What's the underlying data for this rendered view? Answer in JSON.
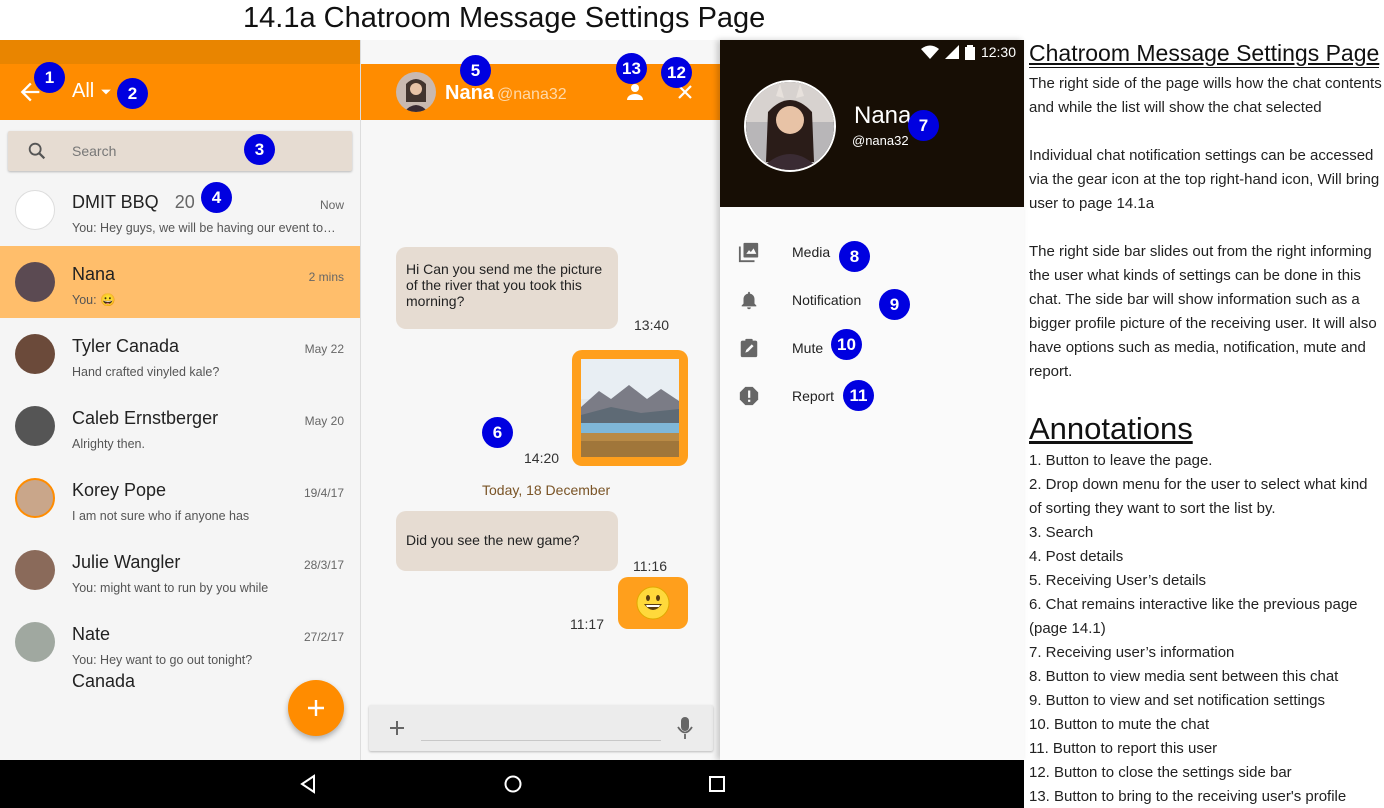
{
  "page_title": "14.1a Chatroom Message Settings Page",
  "list_panel": {
    "filter_label": "All",
    "search_placeholder": "Search",
    "chats": [
      {
        "name": "DMIT BBQ",
        "count": "20",
        "preview": "You: Hey guys, we will be having our event to…",
        "time": "Now",
        "avatar_color": "#ffffff"
      },
      {
        "name": "Nana",
        "count": "",
        "preview": "You: 😀",
        "time": "2 mins",
        "avatar_color": "#5b4a52"
      },
      {
        "name": "Tyler Canada",
        "count": "",
        "preview": "Hand crafted vinyled kale?",
        "time": "May 22",
        "avatar_color": "#6b4a3a"
      },
      {
        "name": "Caleb Ernstberger",
        "count": "",
        "preview": "Alrighty then.",
        "time": "May 20",
        "avatar_color": "#555555"
      },
      {
        "name": "Korey Pope",
        "count": "",
        "preview": "I am not sure who if anyone has",
        "time": "19/4/17",
        "avatar_color": "#c9a68a"
      },
      {
        "name": "Julie Wangler",
        "count": "",
        "preview": "You: might want to run by you while",
        "time": "28/3/17",
        "avatar_color": "#8a6a5a"
      },
      {
        "name": "Nate",
        "count": "",
        "preview": "You: Hey want to go out tonight?",
        "time": "27/2/17",
        "avatar_color": "#a0a8a0"
      }
    ],
    "overflow_text": "Canada"
  },
  "chat_panel": {
    "contact_name": "Nana",
    "contact_handle": "@nana32",
    "messages": [
      {
        "text": "Hi Can you send me the picture of the river that you took this morning?",
        "time": "13:40"
      },
      {
        "time": "14:20"
      },
      {
        "text": "Did you see the new game?",
        "time": "11:16"
      },
      {
        "emoji": "😀",
        "time": "11:17"
      }
    ],
    "date_divider": "Today, 18 December"
  },
  "sidebar": {
    "status_time": "12:30",
    "name": "Nana",
    "handle": "@nana32",
    "menu": [
      {
        "label": "Media",
        "icon": "media-icon"
      },
      {
        "label": "Notification",
        "icon": "bell-icon"
      },
      {
        "label": "Mute",
        "icon": "mute-icon"
      },
      {
        "label": "Report",
        "icon": "report-icon"
      }
    ]
  },
  "markers": [
    "1",
    "2",
    "3",
    "4",
    "5",
    "6",
    "7",
    "8",
    "9",
    "10",
    "11",
    "12",
    "13"
  ],
  "doc": {
    "heading": "Chatroom Message Settings Page",
    "paragraphs": [
      "The right side of the page wills how the chat contents and while the list will show the chat selected",
      "Individual chat notification settings can be accessed via the gear icon at the top right-hand icon, Will bring user to page 14.1a",
      "The right side bar slides out from the right informing the user what kinds of settings can be done in this chat. The side bar will show information such as a bigger profile picture of the receiving user. It will also have options such as media, notification, mute and report."
    ],
    "annotations_heading": "Annotations",
    "annotations": [
      "1. Button to leave the page.",
      "2. Drop down menu for the user to select what kind of sorting they want to sort the list by.",
      "3. Search",
      "4. Post details",
      "5. Receiving User’s details",
      "6. Chat remains interactive like the previous page (page 14.1)",
      "7. Receiving user’s information",
      "8. Button to view media sent between this chat",
      "9. Button to view and set notification settings",
      "10. Button to mute the chat",
      "11. Button to report this user",
      "12. Button to close the settings side bar",
      "13. Button to bring to the receiving user's profile"
    ]
  },
  "colors": {
    "accent": "#ff8c00",
    "accent_dark": "#e98500",
    "selected_row": "#ffbe6b",
    "incoming_bubble": "#e6dcd2",
    "marker": "#0000e0",
    "sidebar_header": "#170e05"
  }
}
